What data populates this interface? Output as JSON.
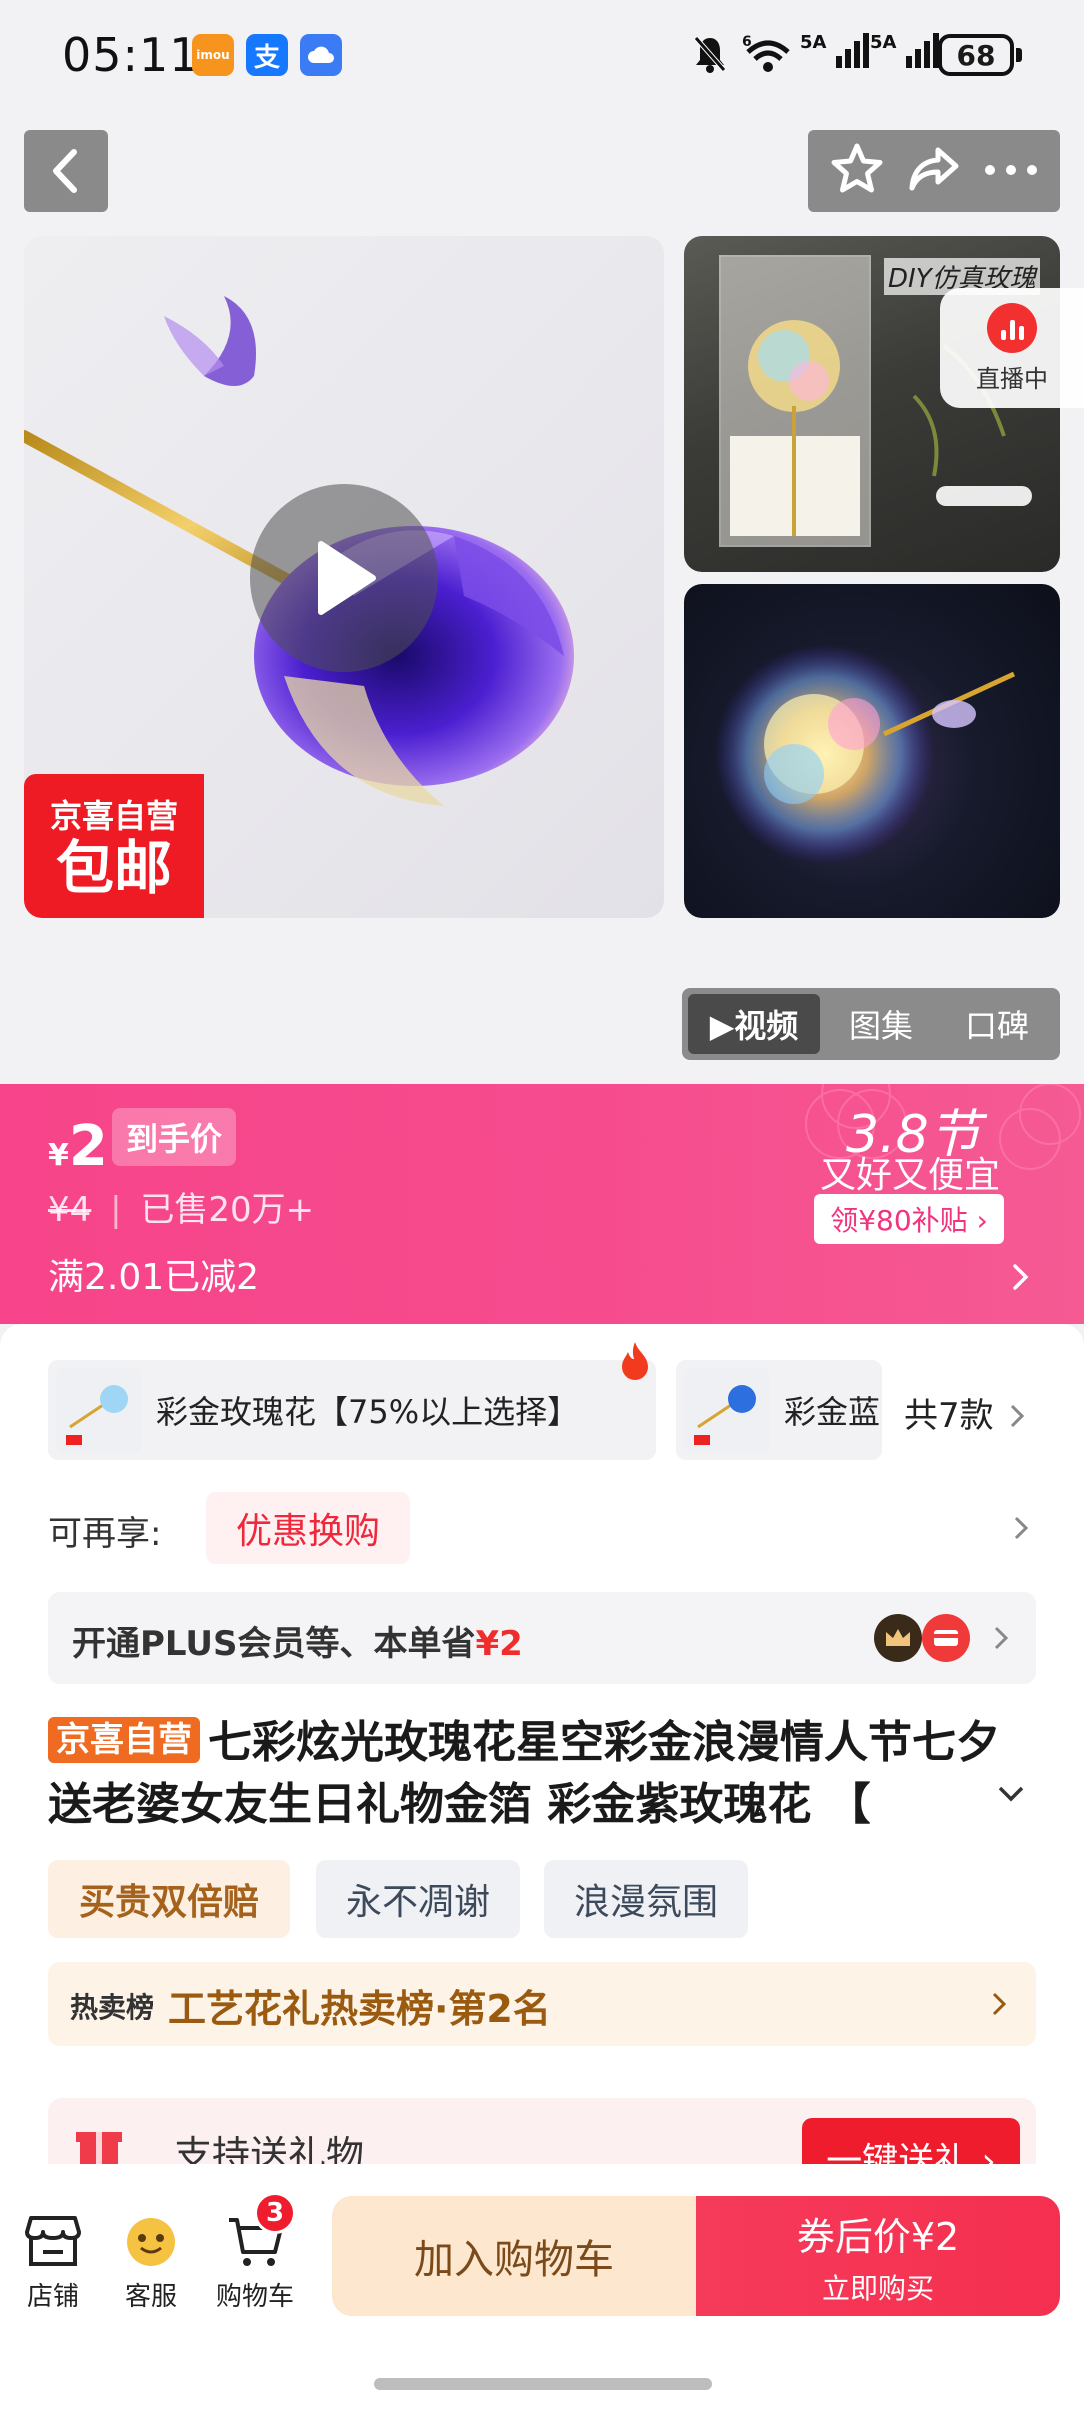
{
  "status_bar": {
    "time": "05:11",
    "apps": [
      {
        "name": "imou",
        "label": "imou",
        "color": "#f7941d"
      },
      {
        "name": "alipay",
        "label": "支",
        "color": "#1677ff"
      },
      {
        "name": "cloud",
        "label": "",
        "color": "#3b7cf5"
      }
    ],
    "signal1": "5A",
    "signal2": "5A",
    "wifi_label": "6",
    "battery": "68"
  },
  "nav": {
    "back_icon": "back-icon",
    "actions": [
      "star-icon",
      "share-icon",
      "more-icon"
    ]
  },
  "gallery": {
    "live_label": "直播中",
    "thumb1_caption": "DIY仿真玫瑰",
    "badge_line1": "京喜自营",
    "badge_line2": "包邮",
    "tabs": [
      "▶视频",
      "图集",
      "口碑"
    ]
  },
  "price": {
    "currency": "¥",
    "amount": "2",
    "tag": "到手价",
    "original": "¥4",
    "sold": "已售20万+",
    "discount": "满2.01已减2",
    "festival_title": "3.8节",
    "festival_sub": "又好又便宜",
    "coupon": "领¥80补贴 ›"
  },
  "variants": [
    {
      "label": "彩金玫瑰花【75%以上选择】",
      "hot": true
    },
    {
      "label": "彩金蓝",
      "hot": false
    }
  ],
  "variant_count": "共7款",
  "reenjoy": {
    "label": "可再享:",
    "tag": "优惠换购"
  },
  "plus": {
    "text": "开通PLUS会员等、本单省",
    "amount": "¥2"
  },
  "title": {
    "tag": "京喜自营",
    "text": "七彩炫光玫瑰花星空彩金浪漫情人节七夕送老婆女友生日礼物金箔 彩金紫玫瑰花 【"
  },
  "features": [
    "买贵双倍赔",
    "永不凋谢",
    "浪漫氛围"
  ],
  "rank": {
    "label": "热卖榜",
    "text": "工艺花礼热卖榜·第2名"
  },
  "gift": {
    "text": "支持送礼物",
    "button": "一键送礼 ›"
  },
  "bottom": {
    "store": "店铺",
    "service": "客服",
    "cart": "购物车",
    "cart_count": "3",
    "add_cart": "加入购物车",
    "buy_price": "券后价¥2",
    "buy_now": "立即购买"
  },
  "colors": {
    "brand_pink": "#f7448a",
    "buy_red": "#f52f4f",
    "add_cart_bg": "#fde7cf",
    "jx_red": "#ee1b24"
  }
}
